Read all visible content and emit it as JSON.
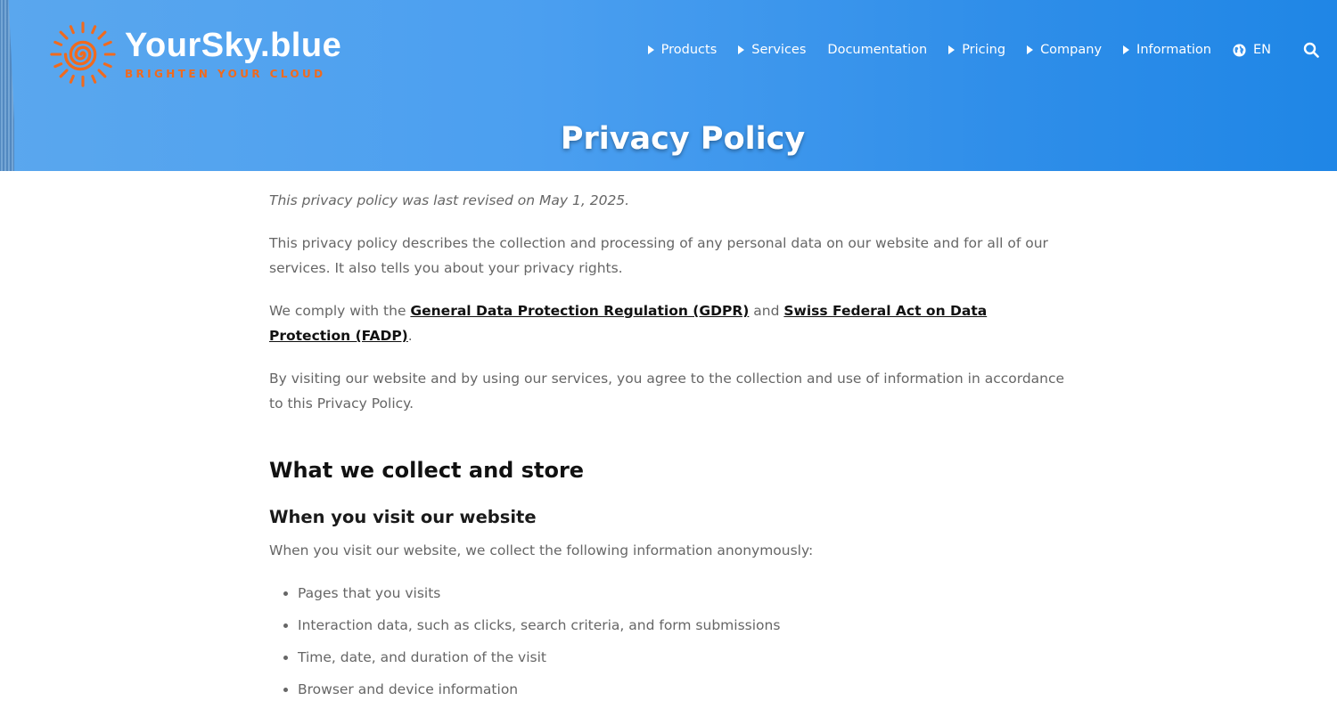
{
  "brand": {
    "name": "YourSky.blue",
    "tagline": "BRIGHTEN YOUR CLOUD",
    "accent_color": "#f06a1e",
    "header_color": "#3b94ec"
  },
  "nav": {
    "items": [
      {
        "label": "Products",
        "has_caret": true
      },
      {
        "label": "Services",
        "has_caret": true
      },
      {
        "label": "Documentation",
        "has_caret": false
      },
      {
        "label": "Pricing",
        "has_caret": true
      },
      {
        "label": "Company",
        "has_caret": true
      },
      {
        "label": "Information",
        "has_caret": true
      }
    ],
    "language": "EN",
    "language_icon": "globe-icon",
    "search_icon": "search-icon"
  },
  "page": {
    "title": "Privacy Policy"
  },
  "content": {
    "revised": "This privacy policy was last revised on May 1, 2025.",
    "intro": "This privacy policy describes the collection and processing of any personal data on our website and for all of our services. It also tells you about your privacy rights.",
    "comply_prefix": "We comply with the ",
    "gdpr_link": "General Data Protection Regulation (GDPR)",
    "comply_and": " and ",
    "fadp_link": "Swiss Federal Act on Data Protection (FADP)",
    "comply_suffix": ".",
    "agree": "By visiting our website and by using our services, you agree to the collection and use of information in accordance to this Privacy Policy.",
    "section_heading": "What we collect and store",
    "subsection_heading": "When you visit our website",
    "visit_intro": "When you visit our website, we collect the following information anonymously:",
    "visit_items": [
      "Pages that you visits",
      "Interaction data, such as clicks, search criteria, and form submissions",
      "Time, date, and duration of the visit",
      "Browser and device information"
    ]
  }
}
